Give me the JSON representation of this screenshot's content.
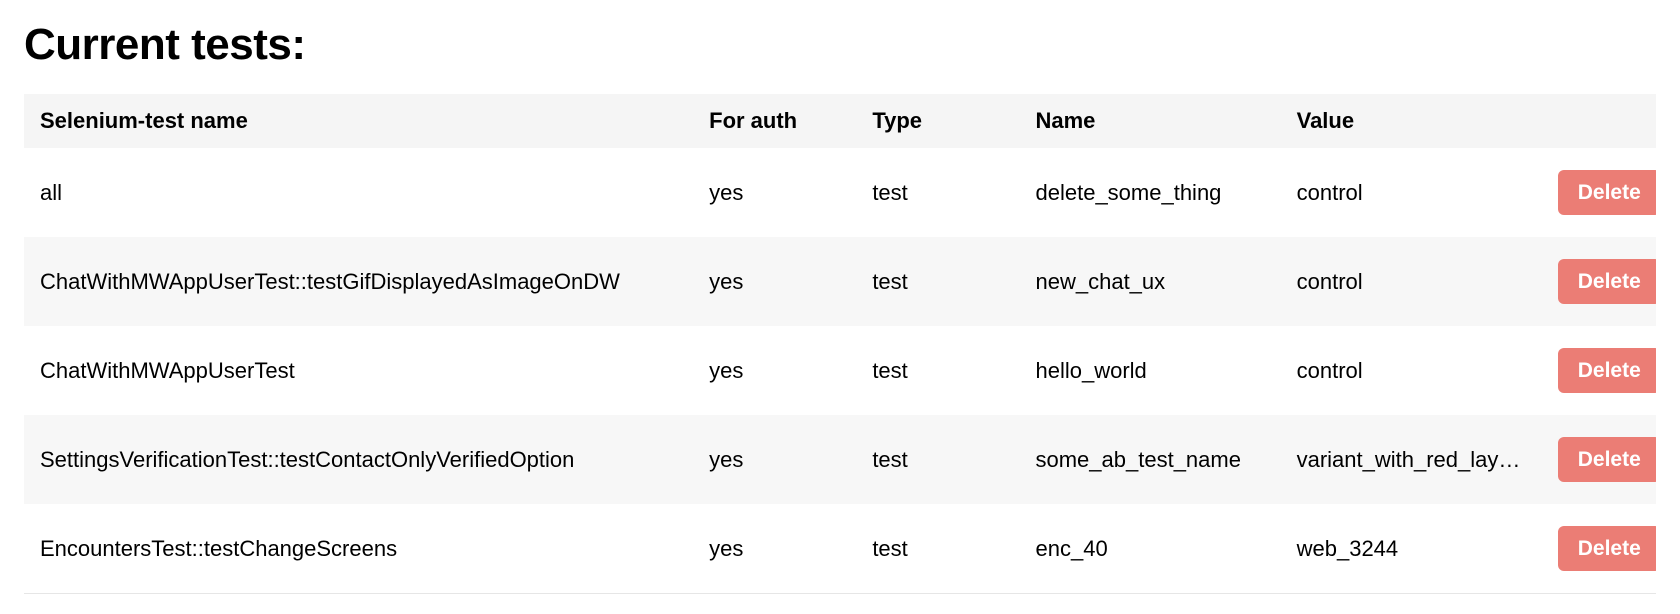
{
  "page": {
    "title": "Current tests:"
  },
  "table": {
    "headers": {
      "test_name": "Selenium-test name",
      "for_auth": "For auth",
      "type": "Type",
      "name": "Name",
      "value": "Value",
      "action": ""
    },
    "delete_label": "Delete",
    "rows": [
      {
        "test_name": "all",
        "for_auth": "yes",
        "type": "test",
        "name": "delete_some_thing",
        "value": "control"
      },
      {
        "test_name": "ChatWithMWAppUserTest::testGifDisplayedAsImageOnDW",
        "for_auth": "yes",
        "type": "test",
        "name": "new_chat_ux",
        "value": "control"
      },
      {
        "test_name": "ChatWithMWAppUserTest",
        "for_auth": "yes",
        "type": "test",
        "name": "hello_world",
        "value": "control"
      },
      {
        "test_name": "SettingsVerificationTest::testContactOnlyVerifiedOption",
        "for_auth": "yes",
        "type": "test",
        "name": "some_ab_test_name",
        "value": "variant_with_red_layout"
      },
      {
        "test_name": "EncountersTest::testChangeScreens",
        "for_auth": "yes",
        "type": "test",
        "name": "enc_40",
        "value": "web_3244"
      }
    ]
  }
}
